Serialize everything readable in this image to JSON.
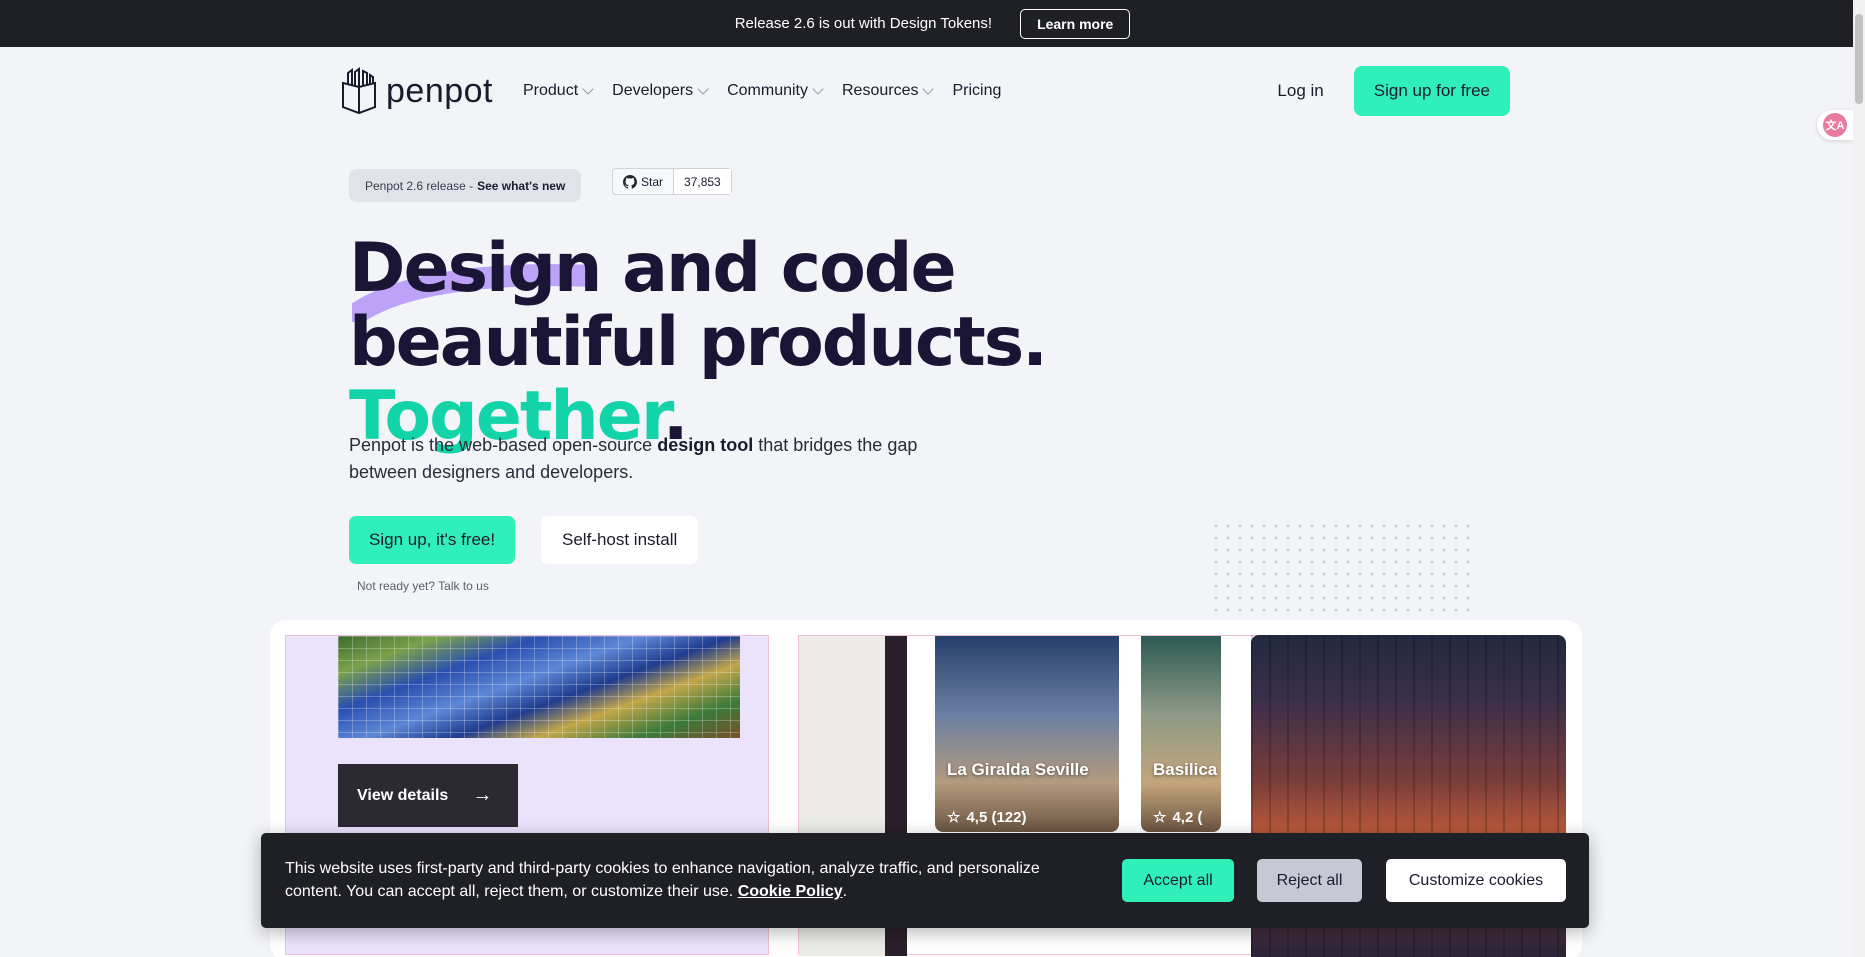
{
  "announcement": {
    "text": "Release 2.6 is out with Design Tokens!",
    "button": "Learn more"
  },
  "nav": {
    "logo": "penpot",
    "items": [
      {
        "label": "Product",
        "has_dropdown": true
      },
      {
        "label": "Developers",
        "has_dropdown": true
      },
      {
        "label": "Community",
        "has_dropdown": true
      },
      {
        "label": "Resources",
        "has_dropdown": true
      },
      {
        "label": "Pricing",
        "has_dropdown": false
      }
    ],
    "login": "Log in",
    "signup": "Sign up for free"
  },
  "release_pill": {
    "prefix": "Penpot 2.6 release -",
    "link": "See what's new"
  },
  "github": {
    "label": "Star",
    "count": "37,853"
  },
  "hero": {
    "title_part1": "Design and code beautiful products.",
    "title_highlight": "Together",
    "title_end": ".",
    "subtitle_before": "Penpot is the web-based open-source",
    "subtitle_bold": "design tool",
    "subtitle_after": "that bridges the gap between designers and developers.",
    "cta_primary": "Sign up, it's free!",
    "cta_secondary": "Self-host install",
    "talk": "Not ready yet? Talk to us"
  },
  "showcase": {
    "view_details": "View details",
    "cards": [
      {
        "name": "La Giralda Seville",
        "rating": "4,5 (122)"
      },
      {
        "name": "Basilica Zaragoza",
        "rating": "4,2 ("
      }
    ]
  },
  "cookie": {
    "text": "This website uses first-party and third-party cookies to enhance navigation, analyze traffic, and personalize content. You can accept all, reject them, or customize their use.",
    "link": "Cookie Policy",
    "end": ".",
    "accept": "Accept all",
    "reject": "Reject all",
    "customize": "Customize cookies"
  },
  "colors": {
    "brand_teal": "#31efb8",
    "dark": "#1f2025",
    "heading": "#1a1535",
    "highlight": "#12d4a8",
    "swoosh": "#b394f7"
  }
}
